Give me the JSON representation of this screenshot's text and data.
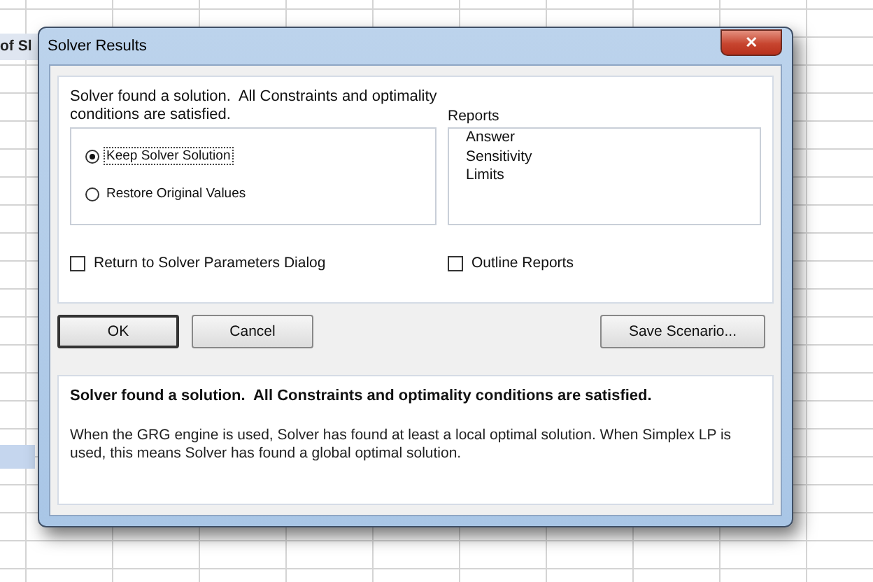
{
  "sheet": {
    "cell_text": "of Sl"
  },
  "window": {
    "title": "Solver Results",
    "close": "✕"
  },
  "message": "Solver found a solution.  All Constraints and optimality conditions are satisfied.",
  "options": [
    {
      "label": "Keep Solver Solution",
      "selected": true
    },
    {
      "label": "Restore Original Values",
      "selected": false
    }
  ],
  "reports": {
    "label": "Reports",
    "items": [
      "Answer",
      "Sensitivity",
      "Limits"
    ]
  },
  "return_dialog": {
    "label": "Return to Solver Parameters Dialog",
    "checked": false
  },
  "outline_reports": {
    "label": "Outline Reports",
    "checked": false
  },
  "buttons": [
    {
      "label": "OK",
      "default": true
    },
    {
      "label": "Cancel",
      "default": false
    }
  ],
  "save_button": "Save Scenario...",
  "details": {
    "heading": "Solver found a solution.  All Constraints and optimality conditions are satisfied.",
    "body": "When the GRG engine is used, Solver has found at least a local optimal solution. When Simplex LP is used, this means Solver has found a global optimal solution."
  }
}
